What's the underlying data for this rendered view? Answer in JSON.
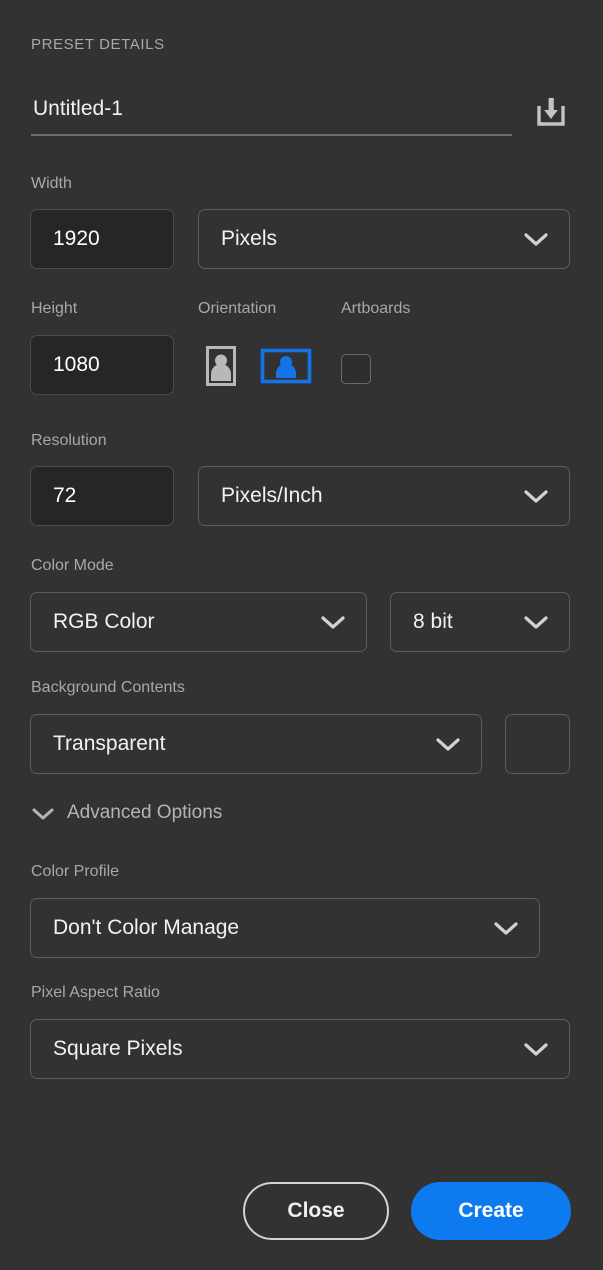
{
  "panel": {
    "title": "PRESET DETAILS",
    "background_color": "#323232"
  },
  "document_name": {
    "value": "Untitled-1",
    "placeholder": "Untitled-1",
    "save_preset_icon": "save-preset-icon"
  },
  "width": {
    "label": "Width",
    "value": "1920",
    "unit": "Pixels"
  },
  "height": {
    "label": "Height",
    "value": "1080"
  },
  "orientation": {
    "label": "Orientation",
    "portrait_icon": "portrait-orientation-icon",
    "landscape_icon": "landscape-orientation-icon",
    "selected": "landscape",
    "selected_color": "#1473e6"
  },
  "artboards": {
    "label": "Artboards",
    "checked": false
  },
  "resolution": {
    "label": "Resolution",
    "value": "72",
    "unit": "Pixels/Inch"
  },
  "color_mode": {
    "label": "Color Mode",
    "value": "RGB Color",
    "depth": "8 bit"
  },
  "background_contents": {
    "label": "Background Contents",
    "value": "Transparent",
    "swatch_color": "#323232"
  },
  "advanced_options": {
    "label": "Advanced Options",
    "expanded": true
  },
  "color_profile": {
    "label": "Color Profile",
    "value": "Don't Color Manage"
  },
  "pixel_aspect_ratio": {
    "label": "Pixel Aspect Ratio",
    "value": "Square Pixels"
  },
  "footer": {
    "close_label": "Close",
    "create_label": "Create",
    "create_color": "#0d7bef"
  }
}
